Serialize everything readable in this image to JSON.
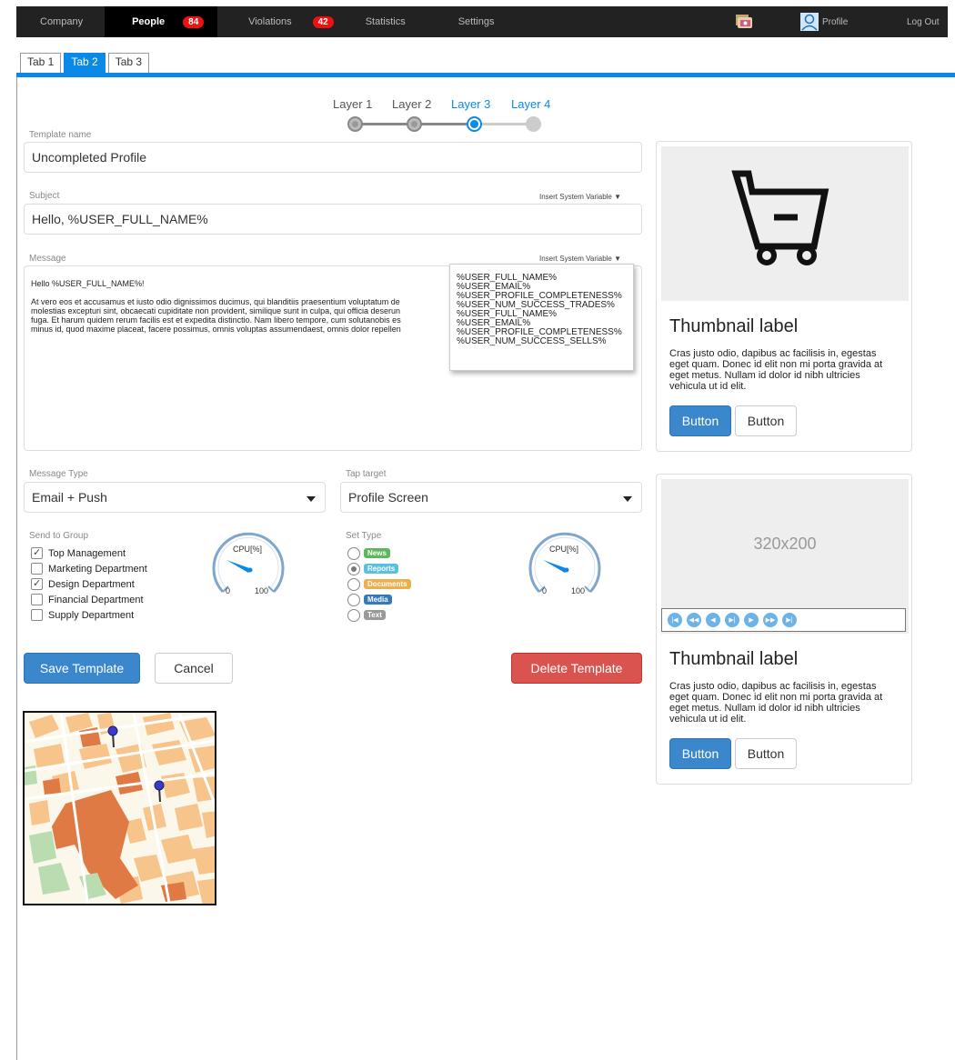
{
  "nav": {
    "company": "Company",
    "people": "People",
    "people_badge": "84",
    "violations": "Violations",
    "violations_badge": "42",
    "statistics": "Statistics",
    "settings": "Settings",
    "profile": "Profile",
    "logout": "Log Out"
  },
  "tabs": [
    "Tab 1",
    "Tab 2",
    "Tab 3"
  ],
  "steps": [
    "Layer 1",
    "Layer 2",
    "Layer 3",
    "Layer 4"
  ],
  "form": {
    "template_name_label": "Template name",
    "template_name_value": "Uncompleted Profile",
    "subject_label": "Subject",
    "insert_variable": "Insert System Variable",
    "subject_value": "Hello, %USER_FULL_NAME%",
    "message_label": "Message",
    "message_greeting": "Hello %USER_FULL_NAME%!",
    "message_lines": [
      "At vero eos et accusamus et iusto odio dignissimos ducimus, qui blanditiis praesentium voluptatum de",
      "molestias excepturi sint, obcaecati cupiditate non provident, similique sunt in culpa, qui officia deserun",
      "fuga. Et harum quidem rerum facilis est et expedita distinctio. Nam libero tempore, cum solutanobis es",
      "minus id, quod maxime placeat, facere possimus, omnis voluptas assumendaest, omnis dolor repellen"
    ],
    "variables": [
      "%USER_FULL_NAME%",
      "%USER_EMAIL%",
      "%USER_PROFILE_COMPLETENESS%",
      "%USER_NUM_SUCCESS_TRADES%",
      "%USER_FULL_NAME%",
      "%USER_EMAIL%",
      "%USER_PROFILE_COMPLETENESS%",
      "%USER_NUM_SUCCESS_SELLS%"
    ],
    "message_type_label": "Message Type",
    "message_type_value": "Email + Push",
    "tap_target_label": "Tap target",
    "tap_target_value": "Profile Screen",
    "send_group_label": "Send to Group",
    "groups": [
      {
        "label": "Top Management",
        "checked": true
      },
      {
        "label": "Marketing Department",
        "checked": false
      },
      {
        "label": "Design Department",
        "checked": true
      },
      {
        "label": "Financial Department",
        "checked": false
      },
      {
        "label": "Supply Department",
        "checked": false
      }
    ],
    "set_type_label": "Set Type",
    "types": [
      {
        "label": "News",
        "color": "#5cb85c",
        "selected": false
      },
      {
        "label": "Reports",
        "color": "#5bc0de",
        "selected": true
      },
      {
        "label": "Documents",
        "color": "#f0ad4e",
        "selected": false
      },
      {
        "label": "Media",
        "color": "#337ab7",
        "selected": false
      },
      {
        "label": "Text",
        "color": "#999999",
        "selected": false
      }
    ],
    "gauge": {
      "title": "CPU[%]",
      "min": "0",
      "max": "100"
    },
    "save_button": "Save Template",
    "cancel_button": "Cancel",
    "delete_button": "Delete Template"
  },
  "cards": [
    {
      "image_icon": "shopping-cart-icon",
      "title": "Thumbnail label",
      "text": "Cras justo odio, dapibus ac facilisis in, egestas eget quam. Donec id elit non mi porta gravida at eget metus. Nullam id dolor id nibh ultricies vehicula ut id elit.",
      "primary": "Button",
      "secondary": "Button"
    },
    {
      "image_label": "320x200",
      "title": "Thumbnail label",
      "text": "Cras justo odio, dapibus ac facilisis in, egestas eget quam. Donec id elit non mi porta gravida at eget metus. Nullam id dolor id nibh ultricies vehicula ut id elit.",
      "primary": "Button",
      "secondary": "Button"
    }
  ],
  "colors": {
    "accent": "#0a8ae6",
    "primary_button": "#3b87cc",
    "danger": "#d9534f",
    "badge": "#e11111"
  }
}
